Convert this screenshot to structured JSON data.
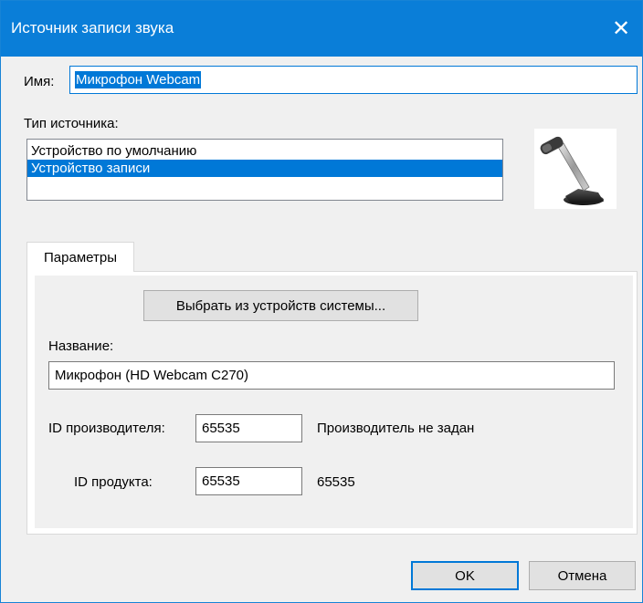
{
  "window": {
    "title": "Источник записи звука"
  },
  "name_field": {
    "label": "Имя:",
    "value": "Микрофон Webcam"
  },
  "source_type": {
    "label": "Тип источника:",
    "items": [
      {
        "label": "Устройство по умолчанию",
        "selected": false
      },
      {
        "label": "Устройство записи",
        "selected": true
      }
    ],
    "icon": "microphone-icon"
  },
  "tabs": [
    {
      "label": "Параметры",
      "active": true
    }
  ],
  "params": {
    "select_button_label": "Выбрать из устройств системы...",
    "device_name_label": "Название:",
    "device_name_value": "Микрофон (HD Webcam C270)",
    "vendor_id_label": "ID производителя:",
    "vendor_id_value": "65535",
    "vendor_id_note": "Производитель не задан",
    "product_id_label": "ID продукта:",
    "product_id_value": "65535",
    "product_id_note": "65535"
  },
  "buttons": {
    "ok_label": "OK",
    "cancel_label": "Отмена"
  },
  "colors": {
    "titlebar": "#0a7ed8",
    "selection": "#0078d7"
  }
}
